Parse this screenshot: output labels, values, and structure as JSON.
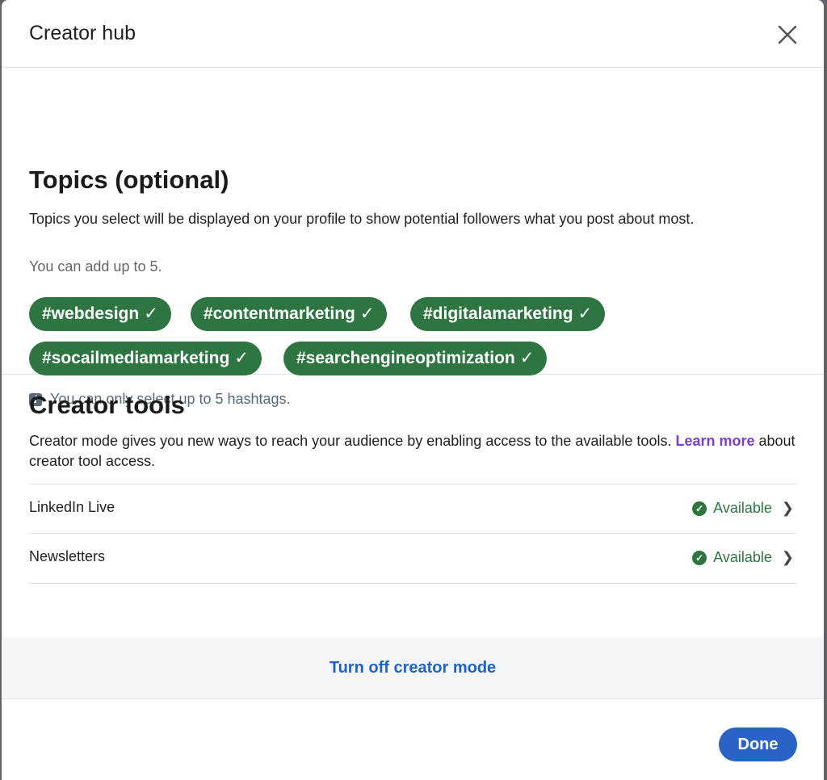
{
  "header": {
    "title": "Creator hub",
    "close_icon": "close-icon"
  },
  "topics": {
    "heading": "Topics (optional)",
    "description": "Topics you select will be displayed on your profile to show potential followers what you post about most.",
    "limit_text": "You can add up to 5.",
    "pills": [
      {
        "label": "#webdesign",
        "check": "✓"
      },
      {
        "label": "#contentmarketing",
        "check": "✓"
      },
      {
        "label": "#digitalamarketing",
        "check": "✓"
      },
      {
        "label": "#socailmediamarketing",
        "check": "✓"
      },
      {
        "label": "#searchengineoptimization",
        "check": "✓"
      }
    ],
    "hint_icon": "info-icon",
    "hint_text": "You can only select up to 5 hashtags."
  },
  "tools": {
    "heading": "Creator tools",
    "description_before": "Creator mode gives you new ways to reach your audience by enabling access to the available tools. ",
    "learn_more": "Learn more",
    "description_after": " about creator tool access.",
    "rows": [
      {
        "label": "LinkedIn Live",
        "status": "Available",
        "chevron": "❯"
      },
      {
        "label": "Newsletters",
        "status": "Available",
        "chevron": "❯"
      }
    ]
  },
  "footer": {
    "turn_off_label": "Turn off creator mode",
    "done_label": "Done"
  },
  "colors": {
    "pill_green": "#2e7542",
    "link_purple": "#7a3fc8",
    "primary_blue": "#2a63c6"
  }
}
